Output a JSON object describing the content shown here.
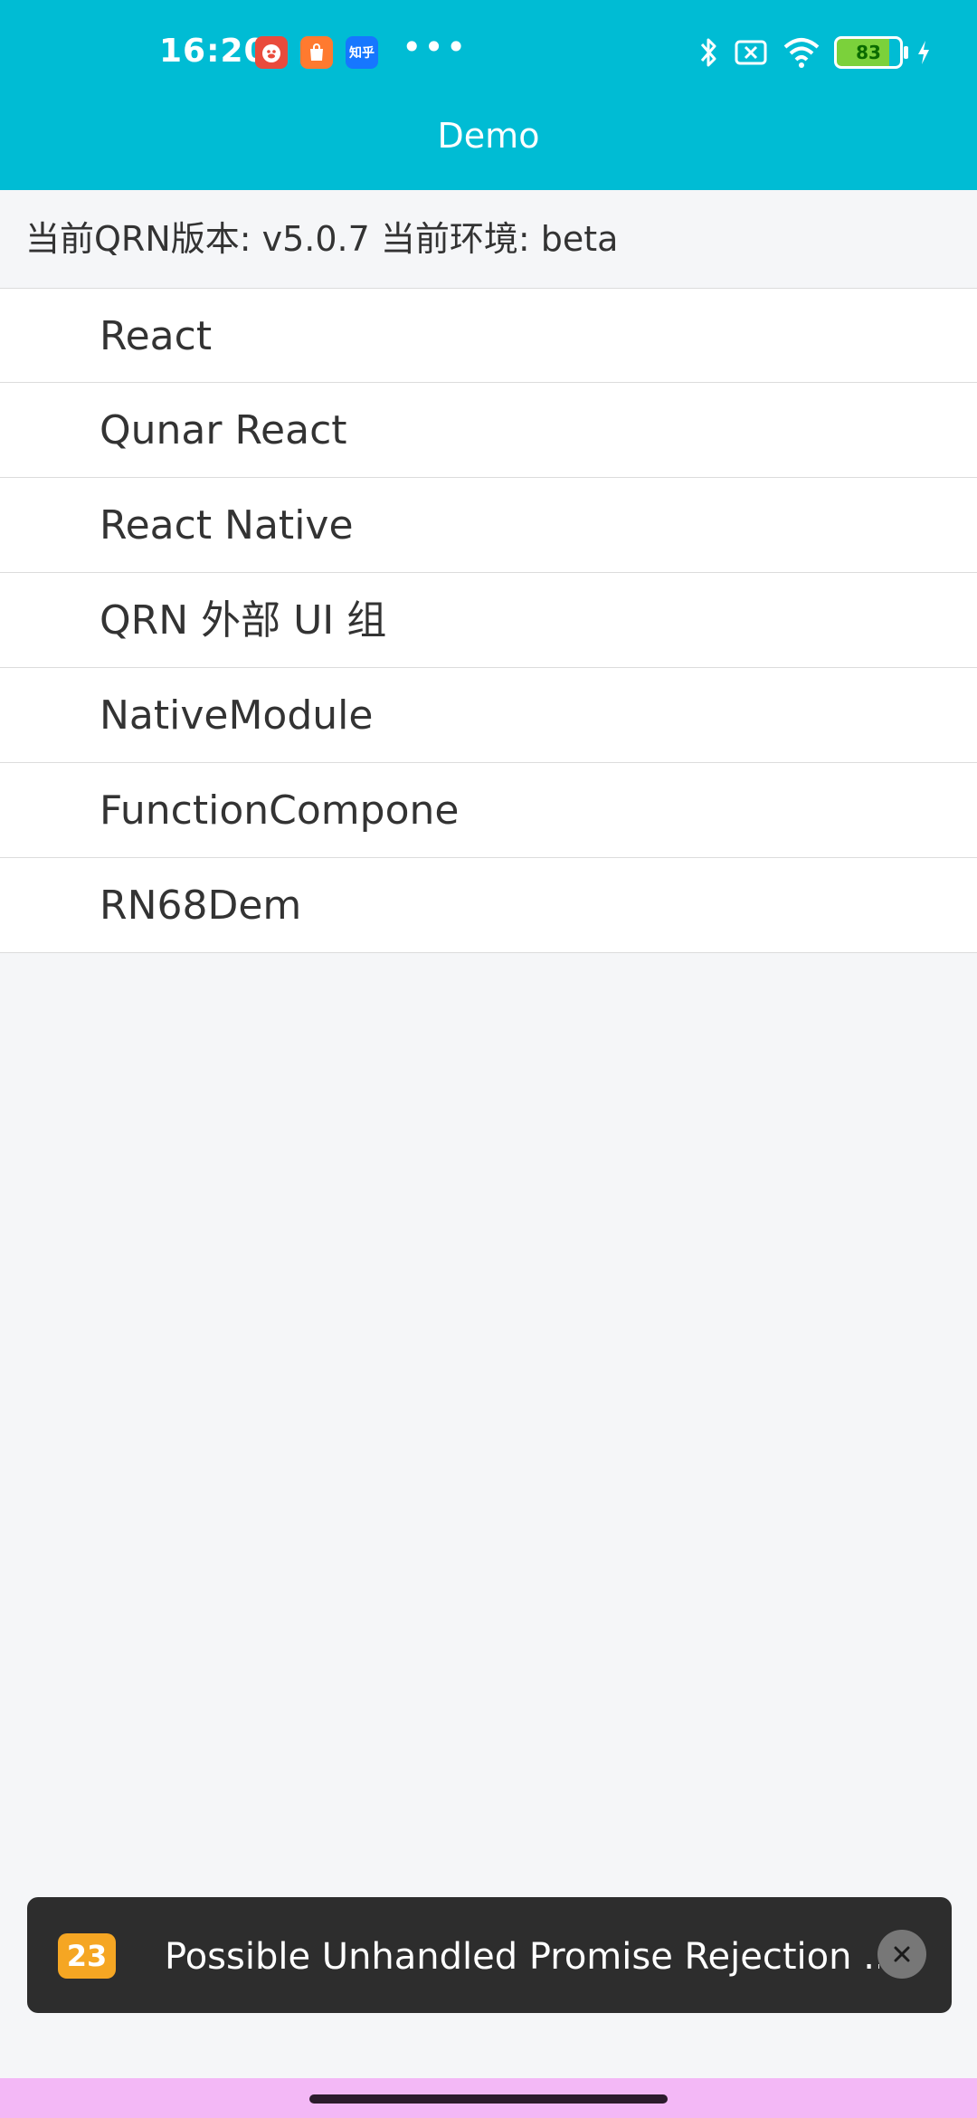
{
  "status_bar": {
    "time": "16:20",
    "app_icons": [
      {
        "name": "red-app-icon",
        "text": "",
        "color": "#e94b3c"
      },
      {
        "name": "orange-app-icon",
        "text": "",
        "color": "#ff7a2f"
      },
      {
        "name": "zhihu-app-icon",
        "text": "知乎",
        "color": "#1677ff"
      }
    ],
    "more": "•••",
    "battery_level": "83"
  },
  "header": {
    "title": "Demo"
  },
  "info": {
    "version_text": "当前QRN版本: v5.0.7 当前环境: beta"
  },
  "menu": {
    "items": [
      {
        "label": "React"
      },
      {
        "label": "Qunar React"
      },
      {
        "label": "React Native"
      },
      {
        "label": "QRN 外部 UI 组"
      },
      {
        "label": "NativeModule"
      },
      {
        "label": "FunctionCompone"
      },
      {
        "label": "RN68Dem"
      }
    ]
  },
  "warning": {
    "count": "23",
    "message": "Possible Unhandled Promise Rejection ...",
    "close_icon": "close-icon"
  },
  "colors": {
    "primary": "#00bcd4",
    "background": "#f5f6f8",
    "warning_badge": "#f5a623"
  }
}
